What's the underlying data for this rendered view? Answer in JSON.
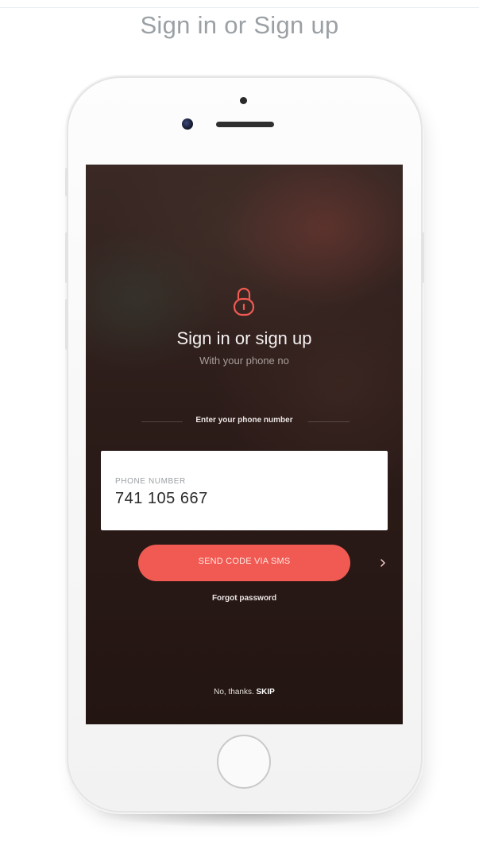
{
  "page": {
    "title": "Sign in or Sign up"
  },
  "screen": {
    "title": "Sign in or sign up",
    "subtitle": "With your phone no",
    "divider_label": "Enter your phone number",
    "phone_field": {
      "label": "PHONE NUMBER",
      "value": "741 105 667"
    },
    "send_button": {
      "label": "SEND CODE VIA SMS",
      "icon": "chevron-right-icon"
    },
    "forgot_password": "Forgot password",
    "skip": {
      "prefix": "No, thanks.",
      "action": "SKIP"
    },
    "lock_icon": "lock-icon"
  },
  "colors": {
    "accent": "#f05a52",
    "screen_bg": "#2a1a17",
    "page_title": "#9aa0a4"
  }
}
